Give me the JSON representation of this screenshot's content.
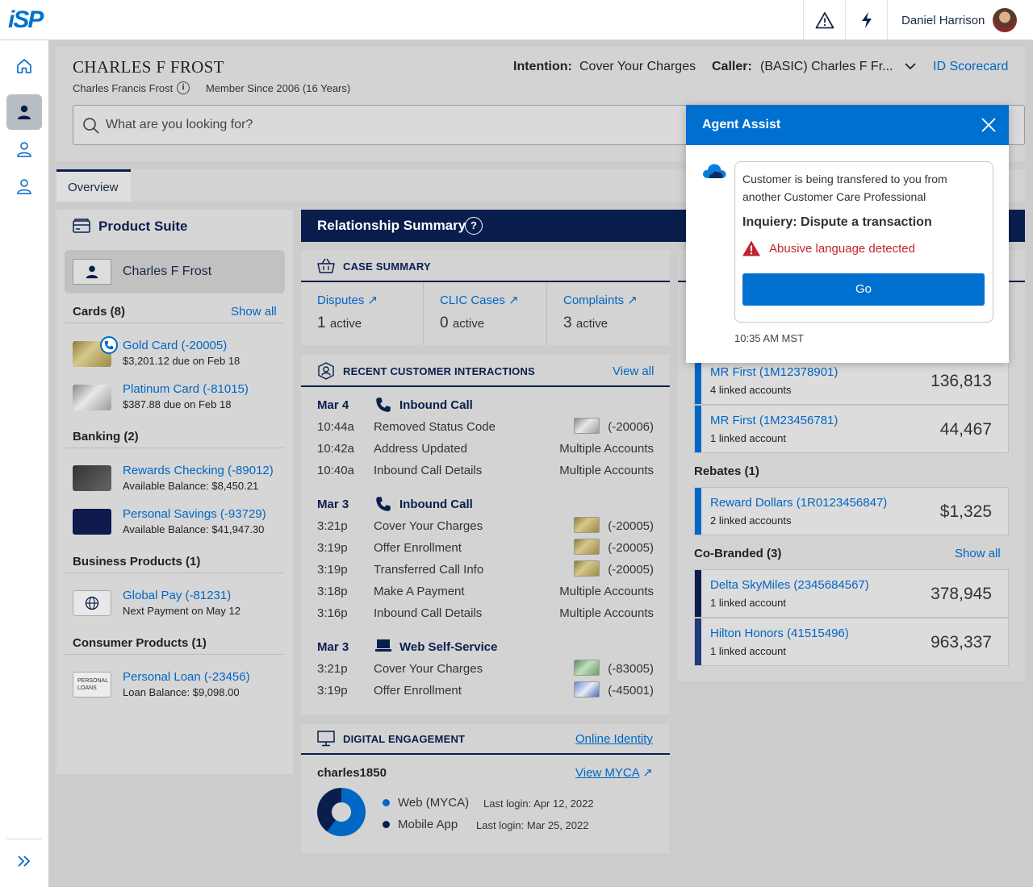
{
  "app": {
    "logo": "iSP",
    "user_name": "Daniel Harrison"
  },
  "customer": {
    "name": "CHARLES F FROST",
    "full_name": "Charles Francis Frost",
    "member_since": "Member Since 2006 (16 Years)",
    "intention_label": "Intention:",
    "intention_value": "Cover Your Charges",
    "caller_label": "Caller:",
    "caller_value": "(BASIC) Charles F Fr...",
    "id_scorecard": "ID Scorecard"
  },
  "search": {
    "placeholder": "What are you looking for?"
  },
  "tabs": [
    {
      "label": "Overview"
    }
  ],
  "product_suite": {
    "title": "Product Suite",
    "customer": "Charles F Frost",
    "show_all": "Show all",
    "cards_header": "Cards (8)",
    "cards": [
      {
        "name": "Gold Card (-20005)",
        "sub": "$3,201.12 due on Feb 18"
      },
      {
        "name": "Platinum Card (-81015)",
        "sub": "$387.88 due on Feb 18"
      }
    ],
    "banking_header": "Banking (2)",
    "banking": [
      {
        "name": "Rewards Checking (-89012)",
        "sub": "Available Balance: $8,450.21"
      },
      {
        "name": "Personal Savings (-93729)",
        "sub": "Available Balance: $41,947.30"
      }
    ],
    "business_header": "Business Products (1)",
    "business": [
      {
        "name": "Global Pay (-81231)",
        "sub": "Next Payment on May 12"
      }
    ],
    "consumer_header": "Consumer Products (1)",
    "consumer": [
      {
        "name": "Personal Loan (-23456)",
        "sub": "Loan Balance: $9,098.00",
        "badge": "PERSONAL LOANS"
      }
    ]
  },
  "relationship": {
    "title": "Relationship Summary"
  },
  "case_summary": {
    "title": "CASE SUMMARY",
    "items": [
      {
        "label": "Disputes",
        "count": "1",
        "unit": "active"
      },
      {
        "label": "CLIC Cases",
        "count": "0",
        "unit": "active"
      },
      {
        "label": "Complaints",
        "count": "3",
        "unit": "active"
      }
    ]
  },
  "interactions": {
    "title": "RECENT CUSTOMER INTERACTIONS",
    "view_all": "View all",
    "groups": [
      {
        "date": "Mar 4",
        "type": "Inbound Call",
        "rows": [
          {
            "time": "10:44a",
            "desc": "Removed Status Code",
            "acct": "(-20006)"
          },
          {
            "time": "10:42a",
            "desc": "Address Updated",
            "acct": "Multiple Accounts"
          },
          {
            "time": "10:40a",
            "desc": "Inbound Call Details",
            "acct": "Multiple Accounts"
          }
        ]
      },
      {
        "date": "Mar 3",
        "type": "Inbound Call",
        "rows": [
          {
            "time": "3:21p",
            "desc": "Cover Your Charges",
            "acct": "(-20005)"
          },
          {
            "time": "3:19p",
            "desc": "Offer Enrollment",
            "acct": "(-20005)"
          },
          {
            "time": "3:19p",
            "desc": "Transferred Call Info",
            "acct": "(-20005)"
          },
          {
            "time": "3:18p",
            "desc": "Make A Payment",
            "acct": "Multiple Accounts"
          },
          {
            "time": "3:16p",
            "desc": "Inbound Call Details",
            "acct": "Multiple Accounts"
          }
        ]
      },
      {
        "date": "Mar 3",
        "type": "Web Self-Service",
        "rows": [
          {
            "time": "3:21p",
            "desc": "Cover Your Charges",
            "acct": "(-83005)"
          },
          {
            "time": "3:19p",
            "desc": "Offer Enrollment",
            "acct": "(-45001)"
          }
        ]
      }
    ]
  },
  "digital": {
    "title": "DIGITAL ENGAGEMENT",
    "online_identity": "Online Identity",
    "username": "charles1850",
    "view_myca": "View MYCA",
    "channels": [
      {
        "name": "Web (MYCA)",
        "last_login": "Last login: Apr 12, 2022",
        "color": "#0067c4"
      },
      {
        "name": "Mobile App",
        "last_login": "Last login: Mar 25, 2022",
        "color": "#0a1e4e"
      }
    ]
  },
  "loyalty": {
    "mr": [
      {
        "name": "MR First (1M12378901)",
        "sub": "4 linked accounts",
        "value": "136,813"
      },
      {
        "name": "MR First (1M23456781)",
        "sub": "1 linked account",
        "value": "44,467"
      }
    ],
    "rebates_header": "Rebates (1)",
    "rebates": [
      {
        "name": "Reward Dollars (1R0123456847)",
        "sub": "2 linked accounts",
        "value": "$1,325"
      }
    ],
    "cobranded_header": "Co-Branded (3)",
    "show_all": "Show all",
    "cobranded": [
      {
        "name": "Delta SkyMiles (2345684567)",
        "sub": "1 linked account",
        "value": "378,945"
      },
      {
        "name": "Hilton Honors (41515496)",
        "sub": "1 linked account",
        "value": "963,337"
      }
    ]
  },
  "agent_assist": {
    "title": "Agent Assist",
    "message": "Customer is being transfered to you from another Customer Care Professional",
    "inquiry": "Inquiery: Dispute a transaction",
    "alert": "Abusive language detected",
    "go": "Go",
    "timestamp": "10:35 AM MST",
    "colors": {
      "header": "#0070d0",
      "alert": "#c0262d"
    }
  }
}
